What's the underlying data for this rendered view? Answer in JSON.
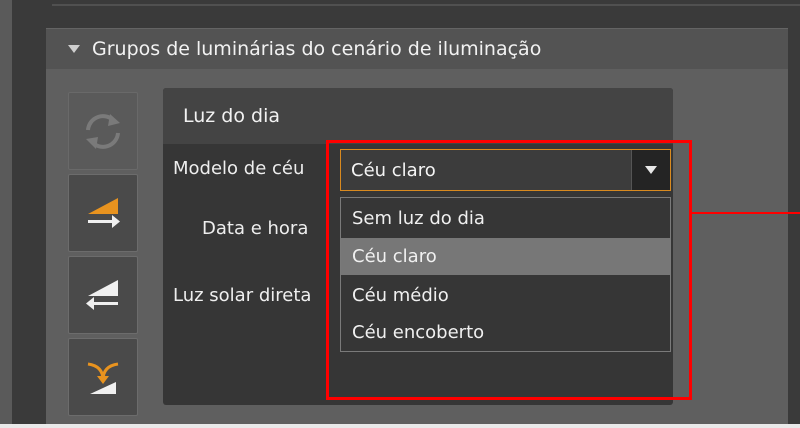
{
  "section": {
    "title": "Grupos de luminárias do cenário de iluminação"
  },
  "daylight_panel": {
    "title": "Luz do dia",
    "sky_model_label": "Modelo de céu",
    "date_time_label": "Data e hora",
    "direct_sunlight_label": "Luz solar direta",
    "sky_model": {
      "selected": "Céu claro",
      "options": [
        {
          "label": "Sem luz do dia"
        },
        {
          "label": "Céu claro",
          "highlighted": true
        },
        {
          "label": "Céu médio"
        },
        {
          "label": "Céu encoberto"
        }
      ]
    }
  },
  "toolbar": {
    "buttons": [
      {
        "icon": "refresh-icon",
        "enabled": false
      },
      {
        "icon": "move-right-icon",
        "enabled": true
      },
      {
        "icon": "move-left-icon",
        "enabled": true
      },
      {
        "icon": "merge-icon",
        "enabled": true
      }
    ]
  },
  "colors": {
    "accent": "#d98a1f",
    "highlight": "#ff0000",
    "panel_bg": "#363636",
    "selected_item": "#777777"
  }
}
